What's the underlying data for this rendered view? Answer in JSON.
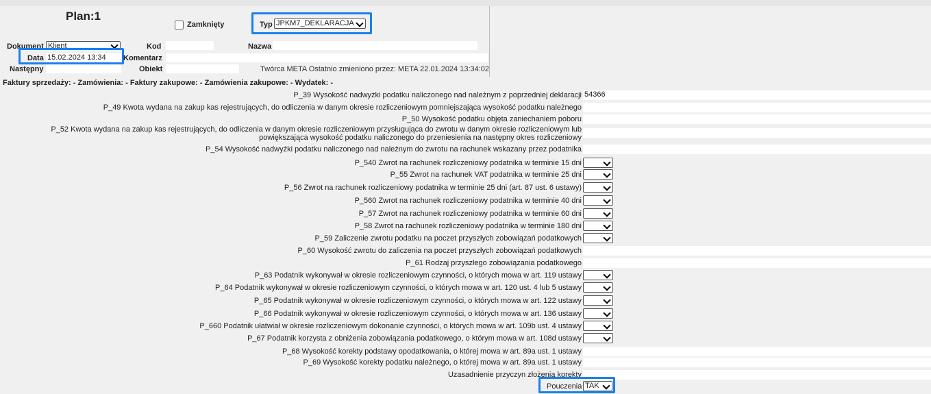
{
  "header": {
    "plan_title": "Plan:1",
    "closed_label": "Zamknięty",
    "closed_checked": false,
    "type_label": "Typ",
    "type_value": "JPKM7_DEKLARACJA",
    "document_label": "Dokument",
    "document_value": "Klient",
    "code_label": "Kod",
    "name_label": "Nazwa",
    "date_label": "Data",
    "date_value": "15.02.2024 13:34",
    "comment_label": "Komentarz",
    "next_label": "Następny",
    "object_label": "Obiekt",
    "author_info": "Twórca META  Ostatnio zmieniono przez: META 22.01.2024 13:34:02"
  },
  "links": "Faktury sprzedaży: - Zamówienia: - Faktury zakupowe: - Zamówienia zakupowe: - Wydatek: -",
  "rows": [
    {
      "label": "P_39 Wysokość nadwyżki podatku naliczonego nad należnym z poprzedniej deklaracji",
      "type": "text",
      "value": "54366"
    },
    {
      "label": "P_49 Kwota wydana na zakup kas rejestrujących, do odliczenia w danym okresie rozliczeniowym pomniejszająca wysokość podatku należnego",
      "type": "text",
      "value": ""
    },
    {
      "label": "P_50 Wysokość podatku objęta zaniechaniem poboru",
      "type": "text",
      "value": ""
    },
    {
      "label": "P_52 Kwota wydana na zakup kas rejestrujących, do odliczenia w danym okresie rozliczeniowym przysługująca do zwrotu w danym okresie rozliczeniowym lub powiększająca wysokość podatku naliczonego do przeniesienia na następny okres rozliczeniowy",
      "type": "text",
      "value": ""
    },
    {
      "label": "P_54 Wysokość nadwyżki podatku naliczonego nad należnym do zwrotu na rachunek wskazany przez podatnika",
      "type": "text",
      "value": ""
    },
    {
      "label": "P_540 Zwrot na rachunek rozliczeniowy podatnika w terminie 15 dni",
      "type": "select",
      "value": ""
    },
    {
      "label": "P_55 Zwrot na rachunek VAT podatnika w terminie 25 dni",
      "type": "select",
      "value": ""
    },
    {
      "label": "P_56 Zwrot na rachunek rozliczeniowy podatnika w terminie 25 dni (art. 87 ust. 6 ustawy)",
      "type": "select",
      "value": ""
    },
    {
      "label": "P_560 Zwrot na rachunek rozliczeniowy podatnika w terminie 40 dni",
      "type": "select",
      "value": ""
    },
    {
      "label": "P_57 Zwrot na rachunek rozliczeniowy podatnika w terminie 60 dni",
      "type": "select",
      "value": ""
    },
    {
      "label": "P_58 Zwrot na rachunek rozliczeniowy podatnika w terminie 180 dni",
      "type": "select",
      "value": ""
    },
    {
      "label": "P_59 Zaliczenie zwrotu podatku na poczet przyszłych zobowiązań podatkowych",
      "type": "select",
      "value": ""
    },
    {
      "label": "P_60 Wysokość zwrotu do zaliczenia na poczet przyszłych zobowiązań podatkowych",
      "type": "text",
      "value": ""
    },
    {
      "label": "P_61 Rodzaj przyszłego zobowiązania podatkowego",
      "type": "text",
      "value": ""
    },
    {
      "label": "P_63 Podatnik wykonywał w okresie rozliczeniowym czynności, o których mowa w art. 119 ustawy",
      "type": "select",
      "value": ""
    },
    {
      "label": "P_64 Podatnik wykonywał w okresie rozliczeniowym czynności, o których mowa w art. 120 ust. 4 lub 5 ustawy",
      "type": "select",
      "value": ""
    },
    {
      "label": "P_65 Podatnik wykonywał w okresie rozliczeniowym czynności, o których mowa w art. 122 ustawy",
      "type": "select",
      "value": ""
    },
    {
      "label": "P_66 Podatnik wykonywał w okresie rozliczeniowym czynności, o których mowa w art. 136 ustawy",
      "type": "select",
      "value": ""
    },
    {
      "label": "P_660 Podatnik ułatwiał w okresie rozliczeniowym dokonanie czynności, o których mowa w art. 109b ust. 4 ustawy",
      "type": "select",
      "value": ""
    },
    {
      "label": "P_67 Podatnik korzysta z obniżenia zobowiązania podatkowego, o którym mowa w art. 108d ustawy",
      "type": "select",
      "value": ""
    },
    {
      "label": "P_68 Wysokość korekty podstawy opodatkowania, o której mowa w art. 89a ust. 1 ustawy",
      "type": "text",
      "value": ""
    },
    {
      "label": "P_69 Wysokość korekty podatku należnego, o której mowa w art. 89a ust. 1 ustawy",
      "type": "text",
      "value": ""
    },
    {
      "label": "Uzasadnienie przyczyn złożenia korekty",
      "type": "text",
      "value": ""
    }
  ],
  "pouczenia": {
    "label": "Pouczenia",
    "value": "TAK"
  },
  "colors": {
    "highlight": "#1a7ff0",
    "background": "#f0f0f0"
  }
}
